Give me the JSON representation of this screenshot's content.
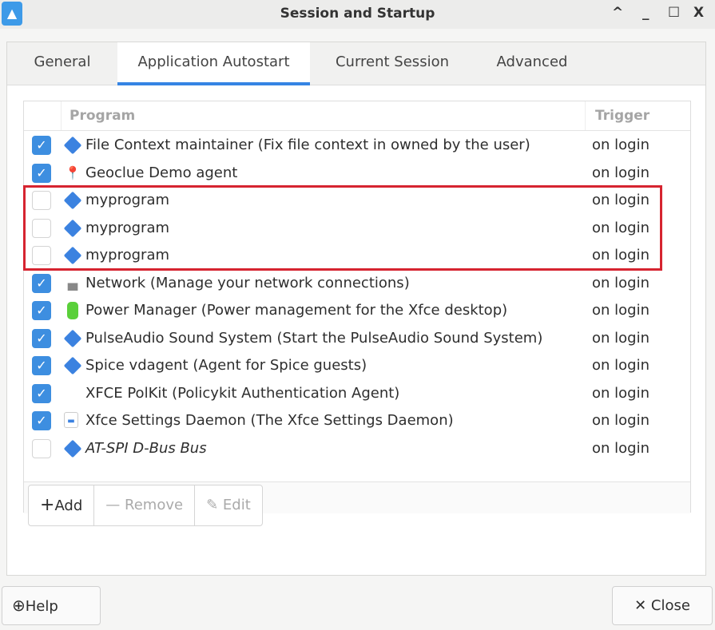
{
  "window": {
    "title": "Session and Startup",
    "controls": [
      "^",
      "_",
      "☐",
      "X"
    ]
  },
  "tabs": [
    {
      "label": "General"
    },
    {
      "label": "Application Autostart",
      "active": true
    },
    {
      "label": "Current Session"
    },
    {
      "label": "Advanced"
    }
  ],
  "table": {
    "headers": {
      "program": "Program",
      "trigger": "Trigger"
    },
    "rows": [
      {
        "checked": true,
        "icon": "diamond-icon",
        "name": "File Context maintainer (Fix file context in owned by the user)",
        "trigger": "on login"
      },
      {
        "checked": true,
        "icon": "map-pin-icon",
        "name": "Geoclue Demo agent",
        "trigger": "on login"
      },
      {
        "checked": false,
        "icon": "diamond-icon",
        "name": "myprogram",
        "trigger": "on login"
      },
      {
        "checked": false,
        "icon": "diamond-icon",
        "name": "myprogram",
        "trigger": "on login"
      },
      {
        "checked": false,
        "icon": "diamond-icon",
        "name": "myprogram",
        "trigger": "on login"
      },
      {
        "checked": true,
        "icon": "network-icon",
        "name": "Network (Manage your network connections)",
        "trigger": "on login"
      },
      {
        "checked": true,
        "icon": "battery-icon",
        "name": "Power Manager (Power management for the Xfce desktop)",
        "trigger": "on login"
      },
      {
        "checked": true,
        "icon": "diamond-icon",
        "name": "PulseAudio Sound System (Start the PulseAudio Sound System)",
        "trigger": "on login"
      },
      {
        "checked": true,
        "icon": "diamond-icon",
        "name": "Spice vdagent (Agent for Spice guests)",
        "trigger": "on login"
      },
      {
        "checked": true,
        "icon": "none",
        "name": "XFCE PolKit (Policykit Authentication Agent)",
        "trigger": "on login"
      },
      {
        "checked": true,
        "icon": "settings-icon",
        "name": "Xfce Settings Daemon (The Xfce Settings Daemon)",
        "trigger": "on login"
      },
      {
        "checked": false,
        "icon": "diamond-icon",
        "name": "AT-SPI D-Bus Bus",
        "trigger": "on login",
        "italic": true
      }
    ]
  },
  "buttons": {
    "add": "Add",
    "remove": "Remove",
    "edit": "Edit",
    "help": "Help",
    "close": "Close"
  },
  "colors": {
    "accent": "#3584e4",
    "highlight": "#d62430"
  }
}
